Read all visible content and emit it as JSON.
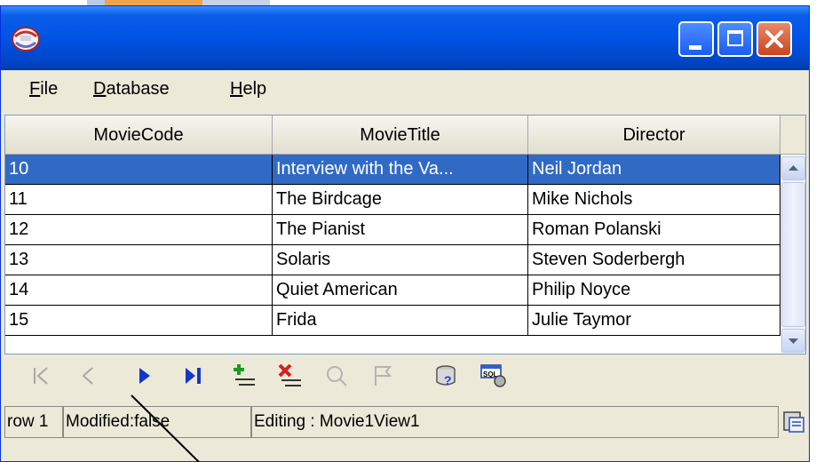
{
  "window": {
    "icon": "app-globe-icon",
    "controls": [
      "minimize-icon",
      "maximize-icon",
      "close-icon"
    ],
    "colors": {
      "titlebar": "#0053e6",
      "selection": "#316ac5",
      "close": "#c9441d"
    }
  },
  "menu": {
    "file": {
      "mnemonic": "F",
      "rest": "ile"
    },
    "database": {
      "mnemonic": "D",
      "rest": "atabase"
    },
    "help": {
      "mnemonic": "H",
      "rest": "elp"
    }
  },
  "table": {
    "columns": [
      "MovieCode",
      "MovieTitle",
      "Director"
    ],
    "rows": [
      {
        "code": "10",
        "title": "Interview with the Va...",
        "director": "Neil Jordan",
        "selected": true
      },
      {
        "code": "11",
        "title": "The Birdcage",
        "director": "Mike Nichols"
      },
      {
        "code": "12",
        "title": "The Pianist",
        "director": "Roman Polanski"
      },
      {
        "code": "13",
        "title": "Solaris",
        "director": "Steven Soderbergh"
      },
      {
        "code": "14",
        "title": "Quiet American",
        "director": "Philip Noyce"
      },
      {
        "code": "15",
        "title": "Frida",
        "director": "Julie Taymor"
      }
    ]
  },
  "navigator": {
    "buttons": [
      "first-record-icon",
      "previous-record-icon",
      "next-record-icon",
      "last-record-icon",
      "insert-record-icon",
      "delete-record-icon",
      "commit-icon",
      "rollback-icon",
      "find-icon",
      "sql-icon"
    ]
  },
  "status": {
    "row": "row 1",
    "modified": "Modified:false",
    "editing": "Editing : Movie1View1",
    "info_icon": "view-info-icon"
  }
}
